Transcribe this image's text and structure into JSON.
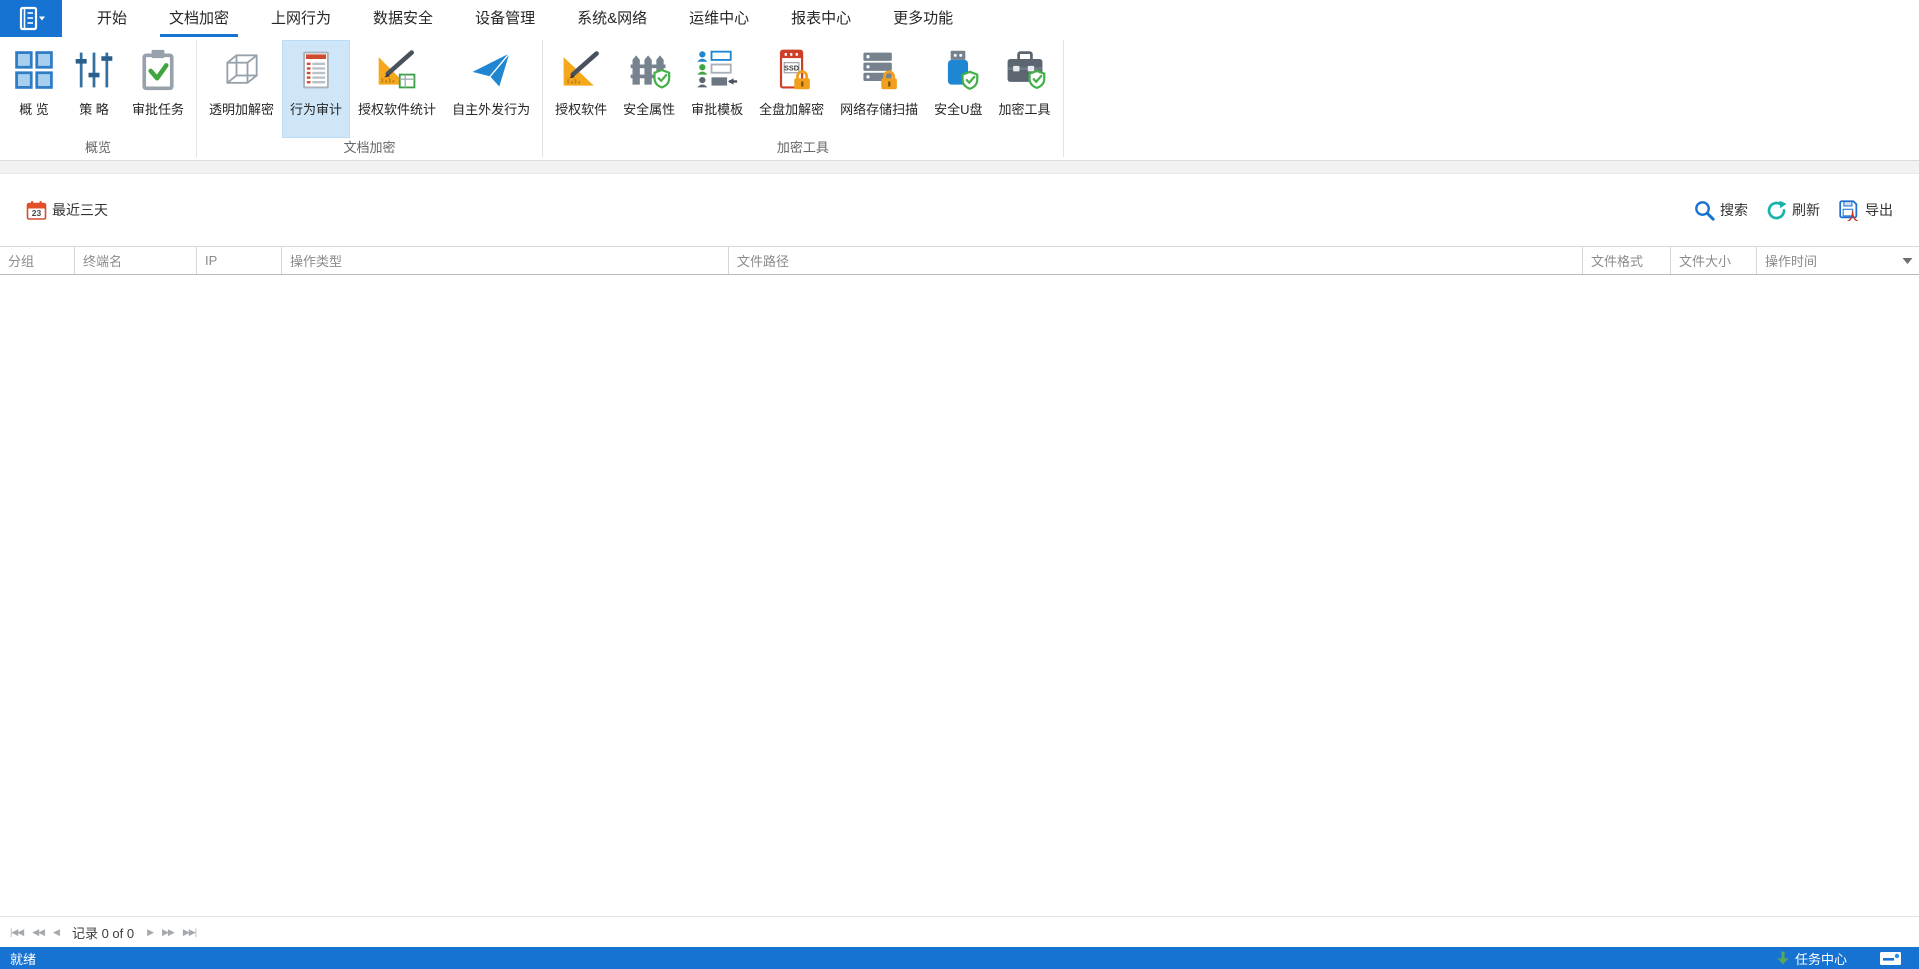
{
  "tabs": {
    "items": [
      {
        "label": "开始"
      },
      {
        "label": "文档加密",
        "active": true
      },
      {
        "label": "上网行为"
      },
      {
        "label": "数据安全"
      },
      {
        "label": "设备管理"
      },
      {
        "label": "系统&网络"
      },
      {
        "label": "运维中心"
      },
      {
        "label": "报表中心"
      },
      {
        "label": "更多功能"
      }
    ]
  },
  "ribbon": {
    "ssd_badge": "SSD",
    "groups": [
      {
        "label": "概览",
        "buttons": [
          {
            "label": "概 览"
          },
          {
            "label": "策 略"
          },
          {
            "label": "审批任务"
          }
        ]
      },
      {
        "label": "文档加密",
        "buttons": [
          {
            "label": "透明加解密"
          },
          {
            "label": "行为审计",
            "selected": true
          },
          {
            "label": "授权软件统计"
          },
          {
            "label": "自主外发行为"
          }
        ]
      },
      {
        "label": "加密工具",
        "buttons": [
          {
            "label": "授权软件"
          },
          {
            "label": "安全属性"
          },
          {
            "label": "审批模板"
          },
          {
            "label": "全盘加解密"
          },
          {
            "label": "网络存储扫描"
          },
          {
            "label": "安全U盘"
          },
          {
            "label": "加密工具"
          }
        ]
      }
    ]
  },
  "toolbar": {
    "calendar_day": "23",
    "date_filter": "最近三天",
    "search": "搜索",
    "refresh": "刷新",
    "export": "导出"
  },
  "table": {
    "columns": [
      {
        "label": "分组"
      },
      {
        "label": "终端名"
      },
      {
        "label": "IP"
      },
      {
        "label": "操作类型"
      },
      {
        "label": "文件路径"
      },
      {
        "label": "文件格式"
      },
      {
        "label": "文件大小"
      },
      {
        "label": "操作时间"
      }
    ],
    "rows": []
  },
  "pagination": {
    "first": "|◀◀",
    "fast_prev": "◀◀",
    "prev": "◀",
    "record": "记录 0 of 0",
    "next": "▶",
    "fast_next": "▶▶",
    "last": "▶▶|"
  },
  "statusbar": {
    "ready": "就绪",
    "task_center": "任务中心"
  },
  "colors": {
    "accent": "#1673d2",
    "selected_tile": "#cfe6f8",
    "ribbon_band": "#f2f2f2",
    "lock_orange": "#f0a01d",
    "shield_green": "#43b049",
    "audit_red": "#cf4a2e",
    "refresh_teal": "#17b3a9"
  }
}
